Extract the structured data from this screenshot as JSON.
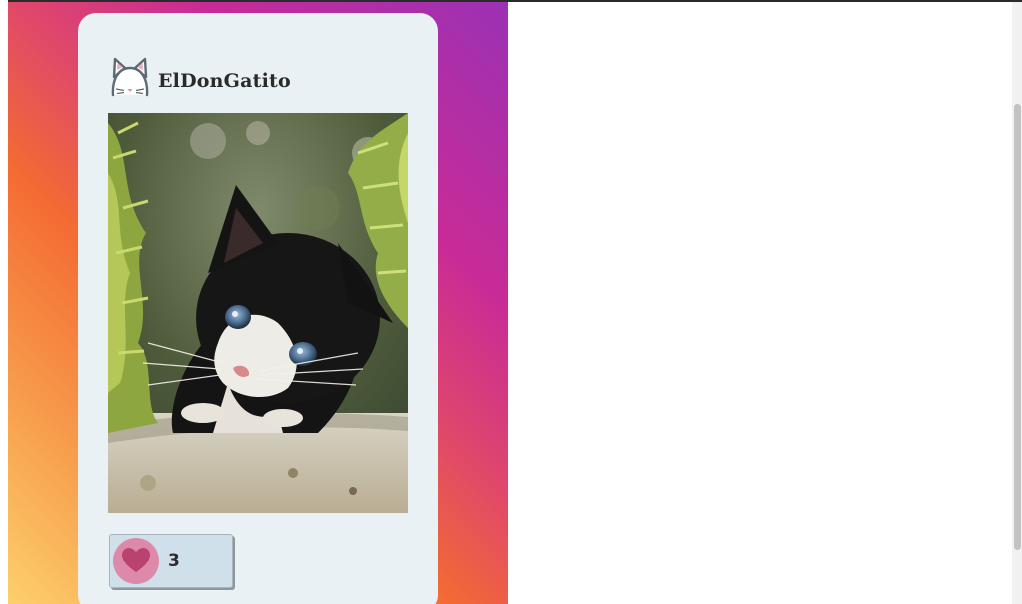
{
  "post": {
    "username": "ElDonGatito",
    "avatar_icon": "cat-face-icon",
    "photo_subject": "black-and-white-kitten",
    "like_icon": "heart-icon",
    "like_count": "3"
  },
  "colors": {
    "gradient": [
      "#fdd06c",
      "#f46b33",
      "#c92b96",
      "#9b31b5"
    ],
    "card_background": "#e9f1f4",
    "like_button_background": "#cfe0ea",
    "heart_circle": "#dd8aaa",
    "heart": "#b9426f"
  }
}
